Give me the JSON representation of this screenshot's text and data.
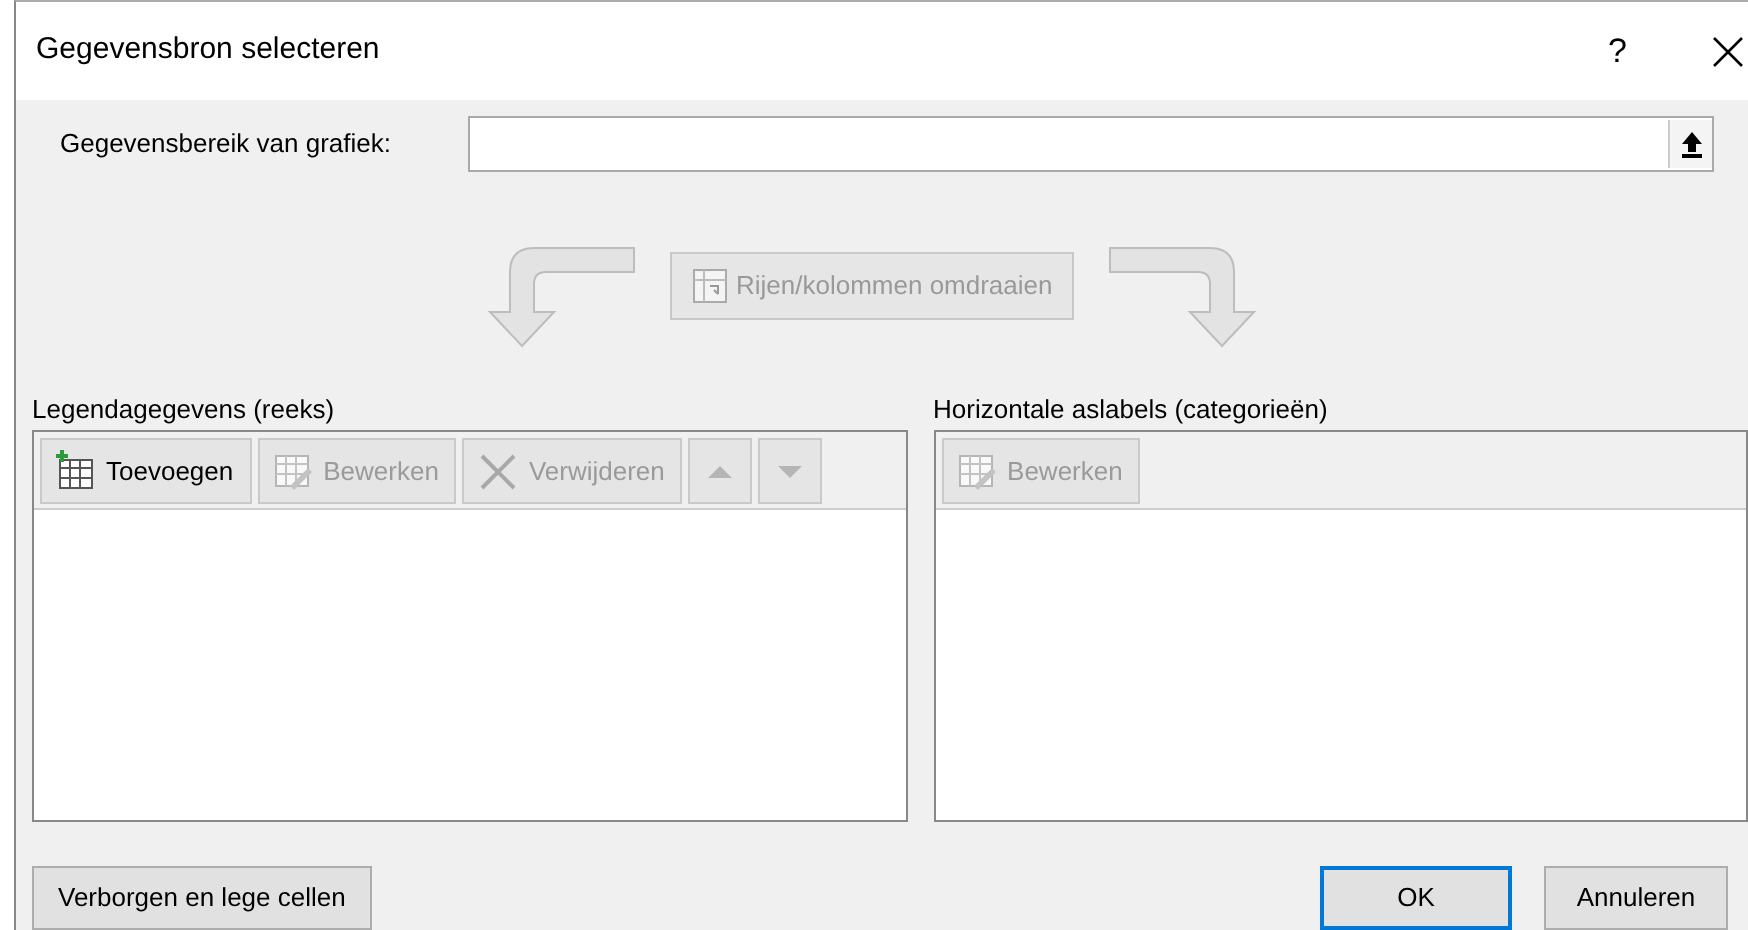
{
  "window": {
    "title": "Gegevensbron selecteren",
    "help": "?"
  },
  "range_field": {
    "label": "Gegevensbereik van grafiek:"
  },
  "switch_button": {
    "label": "Rijen/kolommen omdraaien",
    "disabled": true
  },
  "series_panel": {
    "title": "Legendagegevens (reeks)",
    "toolbar": [
      {
        "kind": "add",
        "label": "Toevoegen",
        "disabled": false
      },
      {
        "kind": "edit",
        "label": "Bewerken",
        "disabled": true
      },
      {
        "kind": "remove",
        "label": "Verwijderen",
        "disabled": true
      },
      {
        "kind": "up",
        "disabled": true
      },
      {
        "kind": "down",
        "disabled": true
      }
    ]
  },
  "categories_panel": {
    "title": "Horizontale aslabels (categorieën)",
    "toolbar": [
      {
        "kind": "edit",
        "label": "Bewerken",
        "disabled": true
      }
    ]
  },
  "footer": {
    "hidden_cells_button": "Verborgen en lege cellen",
    "buttons": [
      {
        "label": "OK",
        "default": true
      },
      {
        "label": "Annuleren",
        "default": false
      }
    ]
  }
}
